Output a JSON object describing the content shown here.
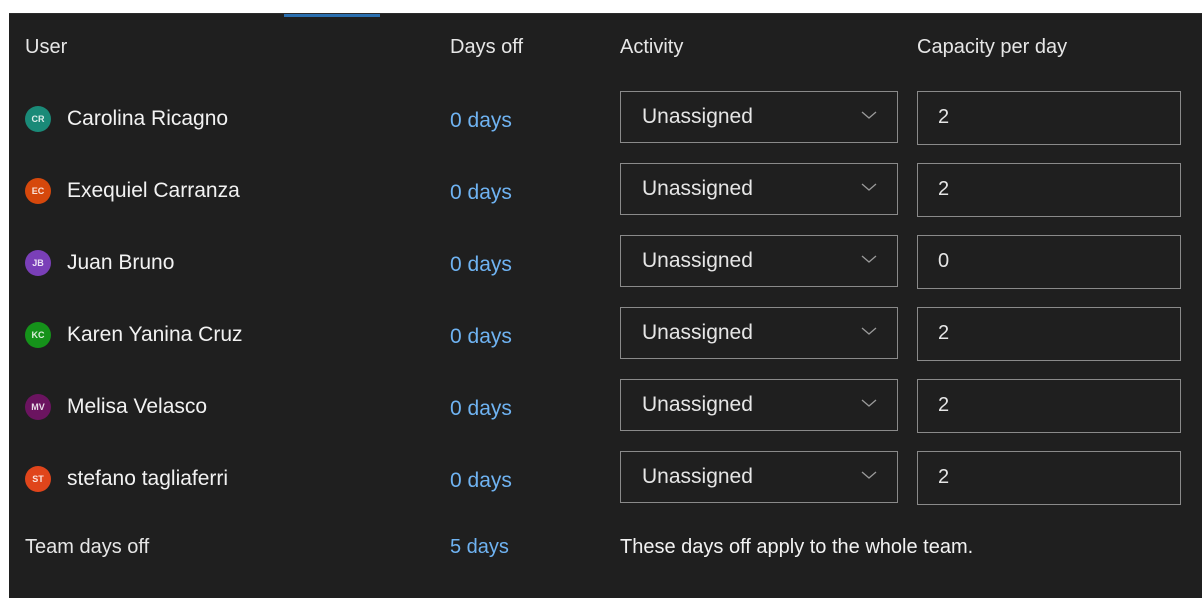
{
  "headers": {
    "user": "User",
    "days_off": "Days off",
    "activity": "Activity",
    "capacity": "Capacity per day"
  },
  "members": [
    {
      "initials": "CR",
      "name": "Carolina Ricagno",
      "days_off": "0 days",
      "activity": "Unassigned",
      "capacity": "2",
      "avatar_color": "#1a8a78"
    },
    {
      "initials": "EC",
      "name": "Exequiel Carranza",
      "days_off": "0 days",
      "activity": "Unassigned",
      "capacity": "2",
      "avatar_color": "#d6480c"
    },
    {
      "initials": "JB",
      "name": "Juan Bruno",
      "days_off": "0 days",
      "activity": "Unassigned",
      "capacity": "0",
      "avatar_color": "#7a3fb8"
    },
    {
      "initials": "KC",
      "name": "Karen Yanina Cruz",
      "days_off": "0 days",
      "activity": "Unassigned",
      "capacity": "2",
      "avatar_color": "#15921a"
    },
    {
      "initials": "MV",
      "name": "Melisa Velasco",
      "days_off": "0 days",
      "activity": "Unassigned",
      "capacity": "2",
      "avatar_color": "#6b1460"
    },
    {
      "initials": "ST",
      "name": "stefano tagliaferri",
      "days_off": "0 days",
      "activity": "Unassigned",
      "capacity": "2",
      "avatar_color": "#e0451b"
    }
  ],
  "footer": {
    "label": "Team days off",
    "days_off": "5 days",
    "note": "These days off apply to the whole team."
  },
  "colors": {
    "background": "#1f1f1f",
    "link": "#6fb3f2",
    "accent": "#2a6fb0"
  },
  "icons": {
    "dropdown": "chevron-down-icon"
  }
}
